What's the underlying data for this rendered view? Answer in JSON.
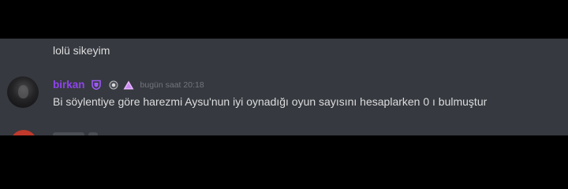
{
  "chat": {
    "previous_message": {
      "text": "lolü sikeyim"
    },
    "message": {
      "author": {
        "name": "birkan",
        "name_color": "#8e44ec",
        "avatar_icon": "avatar-image"
      },
      "badges": [
        {
          "icon": "shield-badge-icon",
          "color": "#9b59f5"
        },
        {
          "icon": "server-booster-icon",
          "color": "#b9bbbe"
        },
        {
          "icon": "triangle-badge-icon",
          "color": "#e6b3ff"
        }
      ],
      "timestamp": "bugün saat 20:18",
      "text": "Bi söylentiye göre harezmi Aysu'nun iyi oynadığı oyun sayısını hesaplarken 0 ı bulmuştur"
    }
  },
  "colors": {
    "chat_background": "#36393f",
    "letterbox": "#000000",
    "text": "#dcddde",
    "timestamp": "#72767d"
  }
}
